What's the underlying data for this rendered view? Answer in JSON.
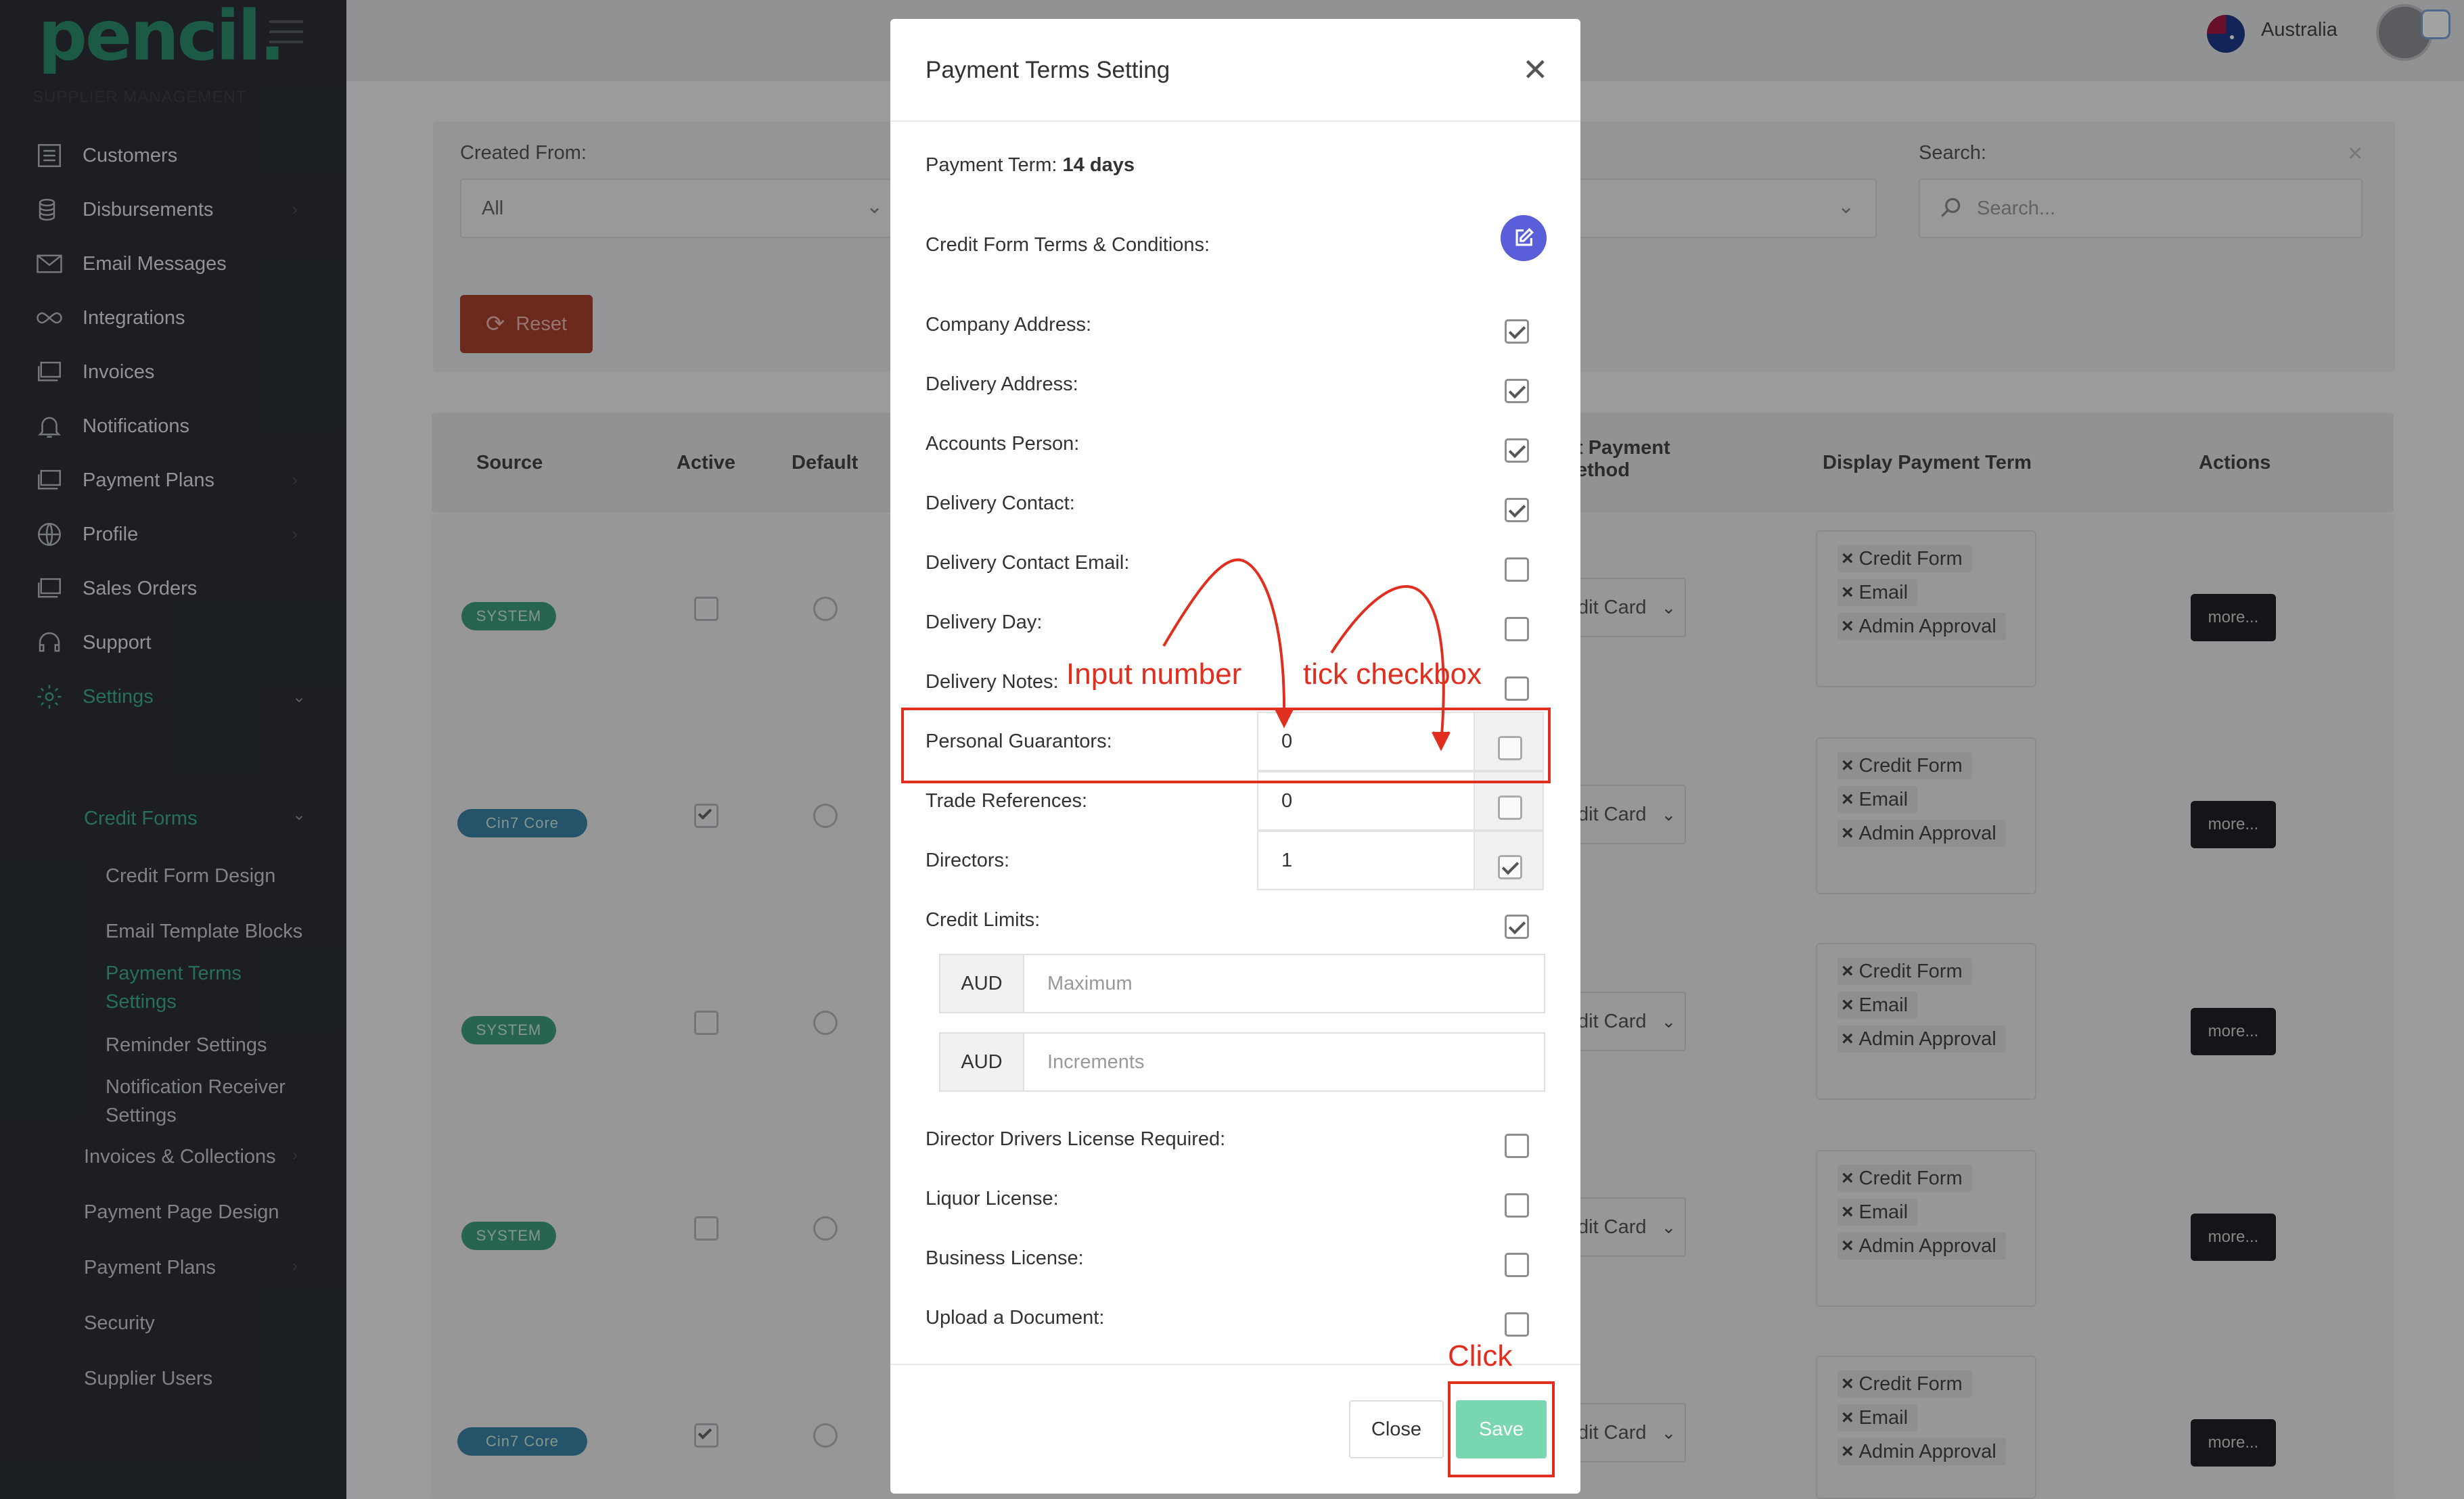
{
  "app": {
    "logo": "pencil.",
    "section_label": "SUPPLIER MANAGEMENT"
  },
  "sidebar": {
    "items": [
      {
        "label": "Customers",
        "icon": "list-icon"
      },
      {
        "label": "Disbursements",
        "icon": "coins-icon"
      },
      {
        "label": "Email Messages",
        "icon": "envelope-icon"
      },
      {
        "label": "Integrations",
        "icon": "infinity-icon"
      },
      {
        "label": "Invoices",
        "icon": "stack-icon"
      },
      {
        "label": "Notifications",
        "icon": "bell-icon"
      },
      {
        "label": "Payment Plans",
        "icon": "stack-icon"
      },
      {
        "label": "Profile",
        "icon": "globe-icon"
      },
      {
        "label": "Sales Orders",
        "icon": "stack-icon"
      },
      {
        "label": "Support",
        "icon": "headset-icon"
      },
      {
        "label": "Settings",
        "icon": "gear-icon"
      }
    ],
    "credit_forms": "Credit Forms",
    "credit_sub": [
      "Credit Form Design",
      "Email Template Blocks",
      "Payment Terms",
      "Settings",
      "Reminder Settings",
      "Notification Receiver",
      "Settings"
    ],
    "settings_sub": [
      "Invoices & Collections",
      "Payment Page Design",
      "Payment Plans",
      "Security",
      "Supplier Users"
    ]
  },
  "topbar": {
    "country": "Australia"
  },
  "filters": {
    "created_from_label": "Created From:",
    "created_from_value": "All",
    "search_label": "Search:",
    "search_placeholder": "Search...",
    "reset": "Reset"
  },
  "table": {
    "headers": {
      "source": "Source",
      "active": "Active",
      "default": "Default",
      "payment_method_1": "t Payment",
      "payment_method_2": "ethod",
      "display_term": "Display Payment Term",
      "actions": "Actions"
    },
    "rows": [
      {
        "source": "SYSTEM",
        "method": "dit Card",
        "active": false
      },
      {
        "source": "Cin7 Core",
        "method": "dit Card",
        "active": true
      },
      {
        "source": "SYSTEM",
        "method": "dit Card",
        "active": false
      },
      {
        "source": "SYSTEM",
        "method": "dit Card",
        "active": false
      },
      {
        "source": "Cin7 Core",
        "method": "dit Card",
        "active": true
      }
    ],
    "tags": [
      "Credit Form",
      "Email",
      "Admin Approval"
    ],
    "more": "more..."
  },
  "modal": {
    "title": "Payment Terms Setting",
    "term_label": "Payment Term:",
    "term_value": "14 days",
    "terms_conditions": "Credit Form Terms & Conditions:",
    "fields": [
      {
        "label": "Company Address:",
        "checked": true
      },
      {
        "label": "Delivery Address:",
        "checked": true
      },
      {
        "label": "Accounts Person:",
        "checked": true
      },
      {
        "label": "Delivery Contact:",
        "checked": true
      },
      {
        "label": "Delivery Contact Email:",
        "checked": false
      },
      {
        "label": "Delivery Day:",
        "checked": false
      },
      {
        "label": "Delivery Notes:",
        "checked": false
      }
    ],
    "number_fields": [
      {
        "label": "Personal Guarantors:",
        "value": "0",
        "checked": false
      },
      {
        "label": "Trade References:",
        "value": "0",
        "checked": false
      },
      {
        "label": "Directors:",
        "value": "1",
        "checked": true
      }
    ],
    "credit_limits": {
      "label": "Credit Limits:",
      "checked": true,
      "currency": "AUD",
      "max_placeholder": "Maximum",
      "inc_placeholder": "Increments"
    },
    "extra_fields": [
      {
        "label": "Director Drivers License Required:",
        "checked": false
      },
      {
        "label": "Liquor License:",
        "checked": false
      },
      {
        "label": "Business License:",
        "checked": false
      },
      {
        "label": "Upload a Document:",
        "checked": false
      }
    ],
    "close": "Close",
    "save": "Save"
  },
  "annotations": {
    "input_number": "Input number",
    "tick_checkbox": "tick checkbox",
    "click": "Click"
  },
  "colors": {
    "sidebar_bg": "#2c3037",
    "brand_green": "#2c8e6e",
    "annotation_red": "#e02e1f",
    "save_green": "#78d7b0",
    "edit_purple": "#5a5fd9"
  }
}
